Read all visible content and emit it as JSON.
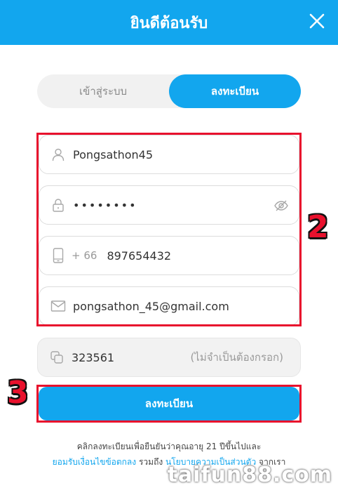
{
  "header": {
    "title": "ยินดีต้อนรับ"
  },
  "tabs": {
    "login": "เข้าสู่ระบบ",
    "register": "ลงทะเบียน"
  },
  "form": {
    "username": "Pongsathon45",
    "password_masked": "••••••••",
    "phone_country_code": "+ 66",
    "phone": "897654432",
    "email": "pongsathon_45@gmail.com",
    "referral_code": "323561",
    "referral_optional": "(ไม่จำเป็นต้องกรอก)"
  },
  "submit_label": "ลงทะเบียน",
  "terms": {
    "line1": "คลิกลงทะเบียนเพื่อยืนยันว่าคุณอายุ 21 ปีขึ้นไปและ",
    "link_terms": "ยอมรับเงื่อนไขข้อตกลง",
    "middle": " รวมถึง ",
    "link_privacy": "นโยบายความเป็นส่วนตัว",
    "end": " จากเรา"
  },
  "annotations": {
    "step2": "2",
    "step3": "3"
  },
  "watermark": "taifun88.com",
  "colors": {
    "accent": "#12a6ee",
    "highlight": "#e8112d"
  }
}
